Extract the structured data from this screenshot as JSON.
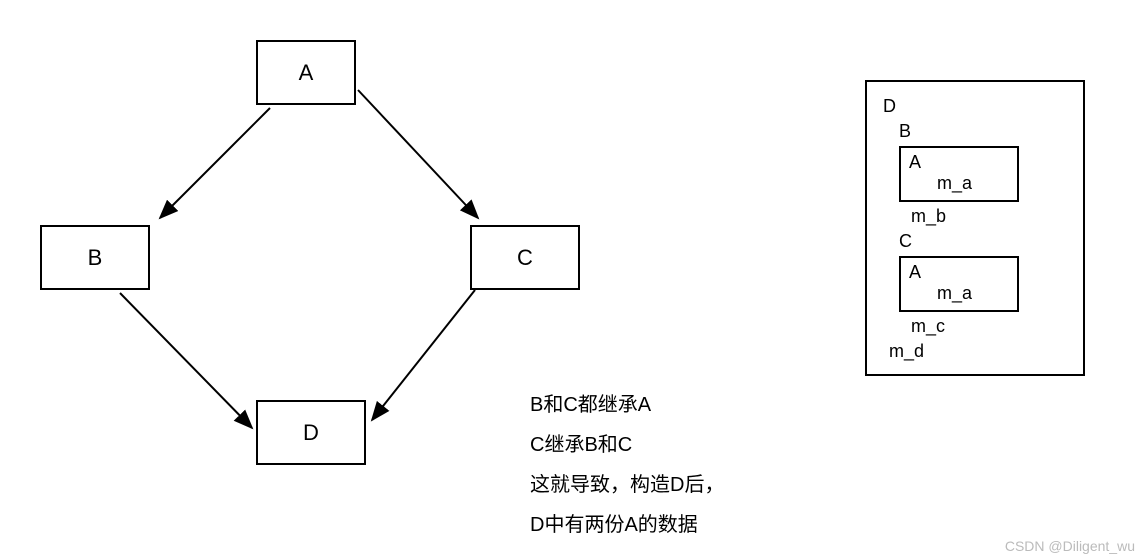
{
  "nodes": {
    "A": "A",
    "B": "B",
    "C": "C",
    "D": "D"
  },
  "explanation": {
    "line1": "B和C都继承A",
    "line2": "C继承B和C",
    "line3": "这就导致，构造D后，",
    "line4": "D中有两份A的数据"
  },
  "memory": {
    "D": "D",
    "B": "B",
    "B_A": "A",
    "B_A_ma": "m_a",
    "B_mb": "m_b",
    "C": "C",
    "C_A": "A",
    "C_A_ma": "m_a",
    "C_mc": "m_c",
    "D_md": "m_d"
  },
  "watermark": "CSDN @Diligent_wu"
}
